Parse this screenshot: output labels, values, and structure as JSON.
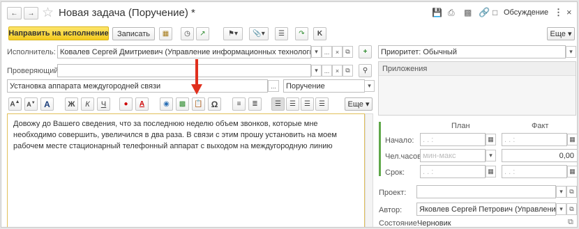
{
  "window": {
    "title": "Новая задача (Поручение) *",
    "discussion_label": "Обсуждение",
    "more_label": "Еще"
  },
  "toolbar": {
    "send_label": "Направить на исполнение",
    "save_label": "Записать",
    "more_label": "Еще"
  },
  "form": {
    "executor_label": "Исполнитель:",
    "executor_value": "Ковалев Сергей Дмитриевич (Управление информационных технологий, Системн",
    "reviewer_label": "Проверяющий:",
    "reviewer_value": "",
    "subject_value": "Установка аппарата междугородней связи",
    "type_value": "Поручение",
    "body_text": "Довожу до Вашего сведения, что за последнюю неделю объем звонков, которые мне необходимо совершить, увеличился в два раза. В связи с этим прошу установить на моем рабочем месте стационарный телефонный аппарат с выходом на междугородную линию"
  },
  "editor": {
    "bold": "Ж",
    "italic": "К",
    "underline": "Ч",
    "omega": "Ω",
    "more_label": "Еще"
  },
  "right": {
    "priority_value": "Приоритет: Обычный",
    "attachments_label": "Приложения",
    "plan_header": "План",
    "fact_header": "Факт",
    "start_label": "Начало:",
    "hours_label": "Чел.часов:",
    "hours_placeholder": "мин-макс",
    "hours_fact": "0,00",
    "due_label": "Срок:",
    "date_mask": ". .   :",
    "project_label": "Проект:",
    "project_value": "",
    "author_label": "Автор:",
    "author_value": "Яковлев Сергей Петрович (Управление инфс",
    "status_label": "Состояние:",
    "status_value": "Черновик"
  },
  "colors": {
    "accent_yellow": "#f6d232",
    "arrow_red": "#e0301e",
    "plan_bar_green": "#5fa84a"
  }
}
